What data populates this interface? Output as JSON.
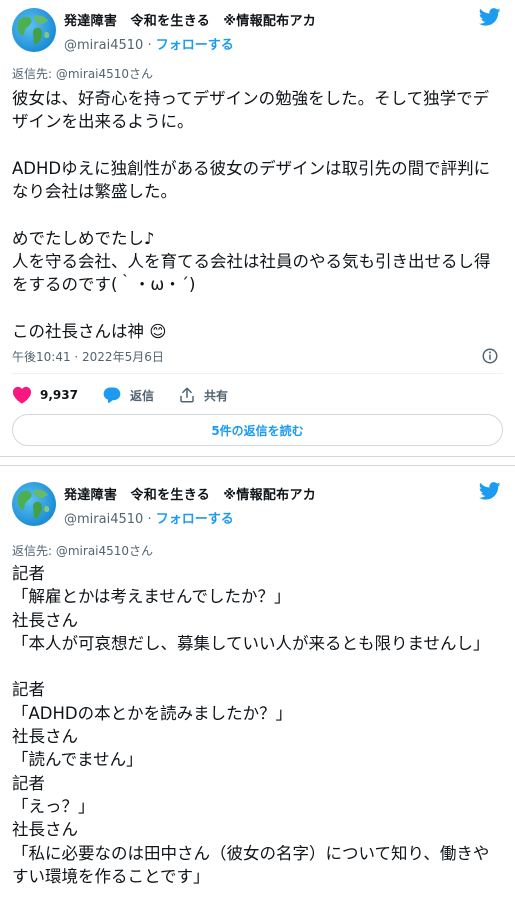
{
  "tweet1": {
    "display_name": "発達障害　令和を生きる　※情報配布アカ",
    "handle": "@mirai4510",
    "separator": "·",
    "follow_label": "フォローする",
    "reply_to": "返信先: @mirai4510さん",
    "body": "彼女は、好奇心を持ってデザインの勉強をした。そして独学でデザインを出来るように。\n\nADHDゆえに独創性がある彼女のデザインは取引先の間で評判になり会社は繁盛した。\n\nめでたしめでたし♪\n人を守る会社、人を育てる会社は社員のやる気も引き出せるし得をするのです(｀・ω・´)\n\nこの社長さんは神",
    "emoji": "😊",
    "timestamp": "午後10:41 · 2022年5月6日",
    "likes": "9,937",
    "reply_label": "返信",
    "share_label": "共有",
    "read_replies_label": "5件の返信を読む"
  },
  "tweet2": {
    "display_name": "発達障害　令和を生きる　※情報配布アカ",
    "handle": "@mirai4510",
    "separator": "·",
    "follow_label": "フォローする",
    "reply_to": "返信先: @mirai4510さん",
    "body": "記者\n「解雇とかは考えませんでしたか？」\n社長さん\n「本人が可哀想だし、募集していい人が来るとも限りませんし」\n\n記者\n「ADHDの本とかを読みましたか？」\n社長さん\n「読んでません」\n記者\n「えっ？」\n社長さん\n「私に必要なのは田中さん（彼女の名字）について知り、働きやすい環境を作ることです」"
  },
  "colors": {
    "accent": "#1d9bf0",
    "like": "#f91880",
    "secondary_text": "#536471",
    "primary_text": "#0f1419"
  },
  "icons": [
    "avatar-globe-icon",
    "twitter-bird-icon",
    "info-icon",
    "heart-icon",
    "reply-icon",
    "share-icon"
  ]
}
